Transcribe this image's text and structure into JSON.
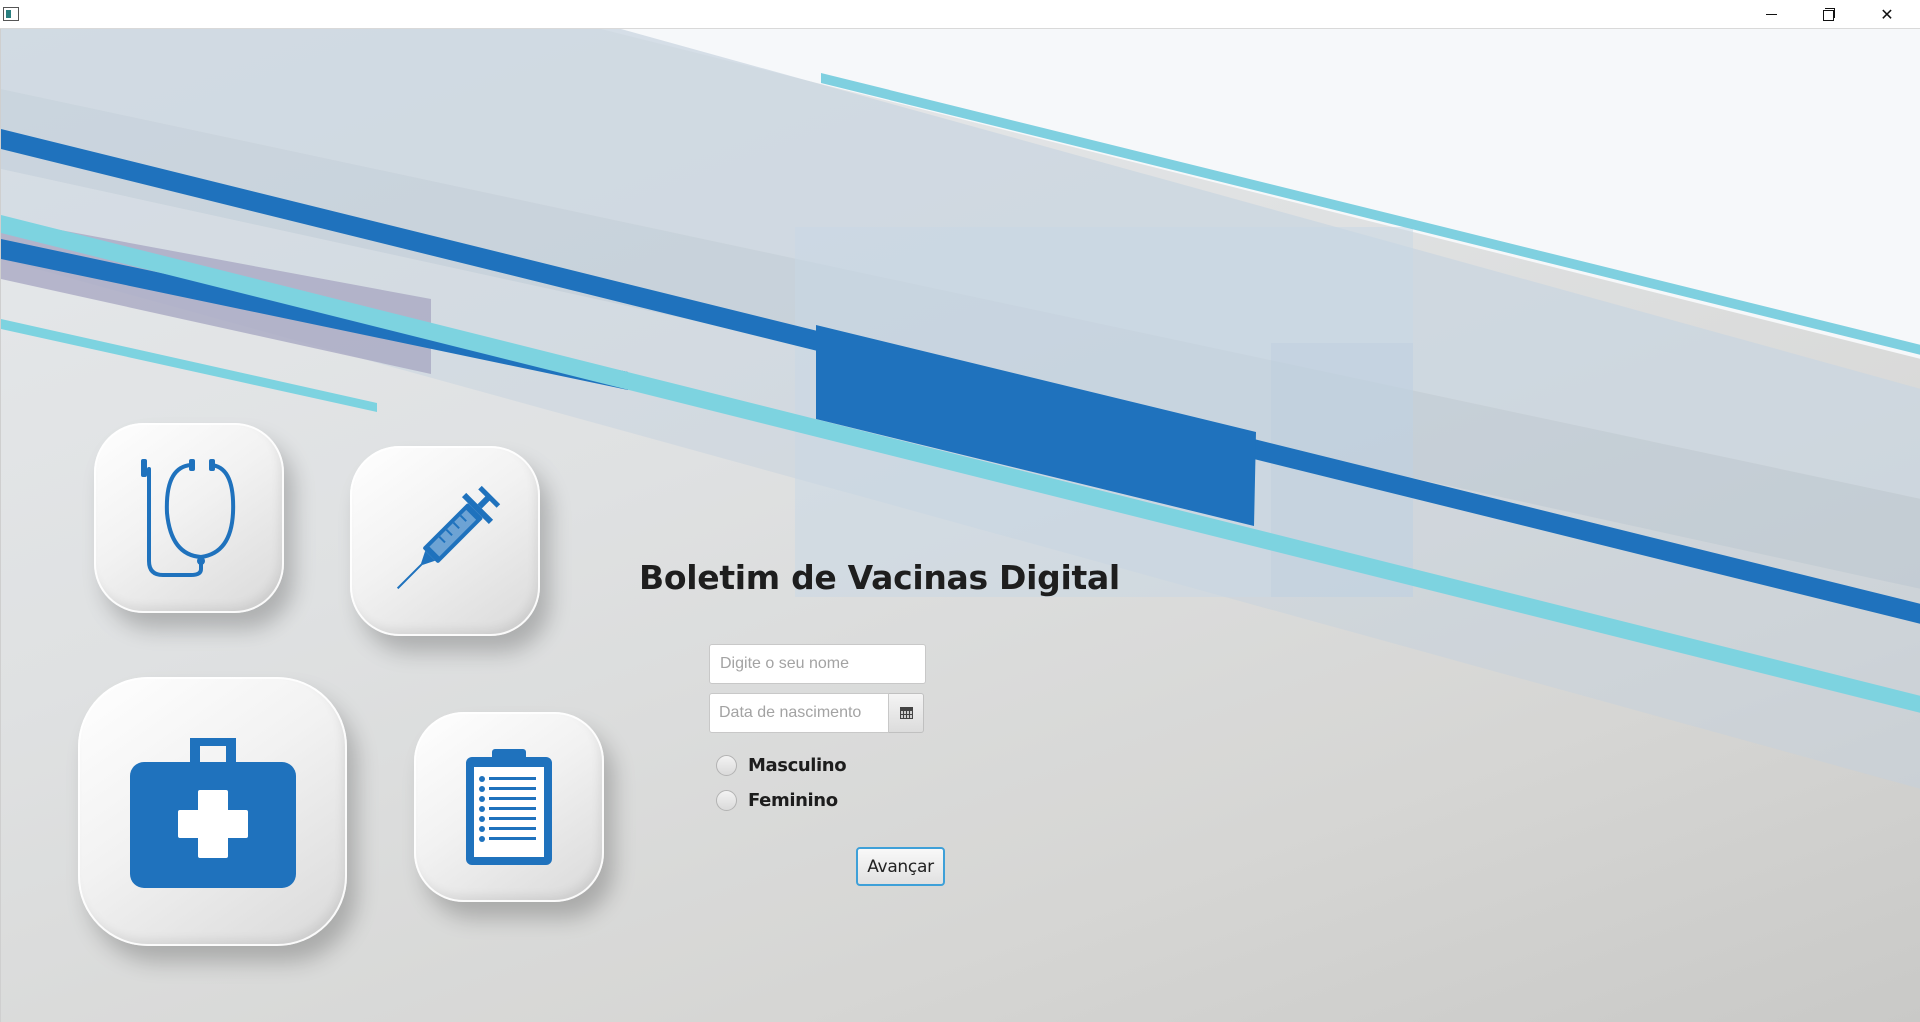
{
  "window": {
    "title": "",
    "controls": {
      "minimize_icon": "minimize-icon",
      "maximize_icon": "restore-icon",
      "close_icon": "close-icon",
      "close_glyph": "✕"
    }
  },
  "main": {
    "title": "Boletim de Vacinas Digital",
    "name_field": {
      "value": "",
      "placeholder": "Digite o seu nome"
    },
    "birth_date_field": {
      "value": "",
      "placeholder": "Data de nascimento",
      "picker_icon": "calendar-icon"
    },
    "gender_options": [
      {
        "label": "Masculino",
        "selected": false
      },
      {
        "label": "Feminino",
        "selected": false
      }
    ],
    "next_button_label": "Avançar"
  },
  "decorative_icons": [
    "stethoscope-icon",
    "syringe-icon",
    "medical-kit-icon",
    "clipboard-icon"
  ],
  "colors": {
    "accent_blue": "#1f72bd",
    "accent_cyan": "#7dd3e0",
    "focus_border": "#3ea0d8",
    "title_text": "#1e1e1e"
  }
}
